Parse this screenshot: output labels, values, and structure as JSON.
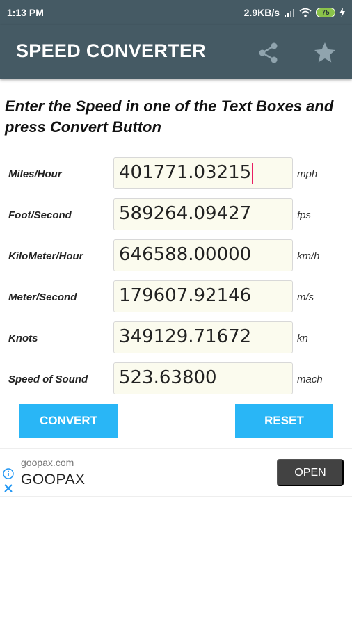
{
  "status_bar": {
    "time": "1:13 PM",
    "network_speed": "2.9KB/s",
    "battery_level": "75",
    "icons": [
      "signal-icon",
      "wifi-icon",
      "battery-icon",
      "charging-icon"
    ]
  },
  "app_bar": {
    "title": "SPEED CONVERTER",
    "actions": [
      "share-icon",
      "star-icon"
    ]
  },
  "instructions": "Enter the Speed in one of the Text Boxes and press Convert Button",
  "rows": [
    {
      "label": "Miles/Hour",
      "value": "401771.03215",
      "unit": "mph",
      "focused": true
    },
    {
      "label": "Foot/Second",
      "value": "589264.09427",
      "unit": "fps"
    },
    {
      "label": "KiloMeter/Hour",
      "value": "646588.00000",
      "unit": "km/h"
    },
    {
      "label": "Meter/Second",
      "value": "179607.92146",
      "unit": "m/s"
    },
    {
      "label": "Knots",
      "value": "349129.71672",
      "unit": "kn"
    },
    {
      "label": "Speed of Sound",
      "value": "523.63800",
      "unit": "mach"
    }
  ],
  "buttons": {
    "convert": "CONVERT",
    "reset": "RESET"
  },
  "ad": {
    "url": "goopax.com",
    "name": "GOOPAX",
    "cta": "OPEN"
  },
  "colors": {
    "app_bar": "#455a64",
    "button": "#29b6f6",
    "field_background": "#fbfbee",
    "caret": "#e91e63",
    "ad_button": "#424242",
    "ad_icon": "#2196f3"
  }
}
